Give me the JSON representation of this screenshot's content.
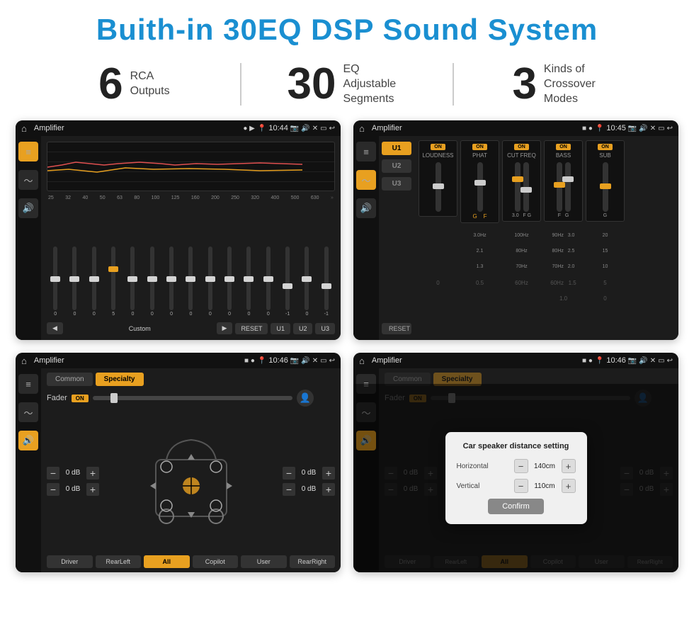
{
  "page": {
    "title": "Buith-in 30EQ DSP Sound System"
  },
  "stats": [
    {
      "number": "6",
      "label": "RCA\nOutputs"
    },
    {
      "number": "30",
      "label": "EQ Adjustable\nSegments"
    },
    {
      "number": "3",
      "label": "Kinds of\nCrossover Modes"
    }
  ],
  "screen1": {
    "status": "Amplifier",
    "time": "10:44",
    "preset": "Custom",
    "freqs": [
      "25",
      "32",
      "40",
      "50",
      "63",
      "80",
      "100",
      "125",
      "160",
      "200",
      "250",
      "320",
      "400",
      "500",
      "630"
    ],
    "values": [
      "0",
      "0",
      "0",
      "5",
      "0",
      "0",
      "0",
      "0",
      "0",
      "0",
      "0",
      "0",
      "-1",
      "0",
      "-1"
    ],
    "thumbPositions": [
      50,
      50,
      50,
      35,
      50,
      50,
      50,
      50,
      50,
      50,
      50,
      50,
      65,
      50,
      65
    ],
    "buttons": [
      "◀",
      "Custom",
      "▶",
      "RESET",
      "U1",
      "U2",
      "U3"
    ]
  },
  "screen2": {
    "status": "Amplifier",
    "time": "10:45",
    "uButtons": [
      "U1",
      "U2",
      "U3"
    ],
    "controls": [
      {
        "label": "LOUDNESS",
        "on": true
      },
      {
        "label": "PHAT",
        "on": true
      },
      {
        "label": "CUT FREQ",
        "on": true
      },
      {
        "label": "BASS",
        "on": true
      },
      {
        "label": "SUB",
        "on": true
      }
    ],
    "resetLabel": "RESET"
  },
  "screen3": {
    "status": "Amplifier",
    "time": "10:46",
    "tabs": [
      "Common",
      "Specialty"
    ],
    "activeTab": "Specialty",
    "faderLabel": "Fader",
    "onLabel": "ON",
    "volumeRows": [
      {
        "value": "0 dB"
      },
      {
        "value": "0 dB"
      },
      {
        "value": "0 dB"
      },
      {
        "value": "0 dB"
      }
    ],
    "buttons": [
      "Driver",
      "RearLeft",
      "All",
      "Copilot",
      "User",
      "RearRight"
    ]
  },
  "screen4": {
    "status": "Amplifier",
    "time": "10:46",
    "tabs": [
      "Common",
      "Specialty"
    ],
    "activeTab": "Specialty",
    "dialog": {
      "title": "Car speaker distance setting",
      "rows": [
        {
          "label": "Horizontal",
          "value": "140cm"
        },
        {
          "label": "Vertical",
          "value": "110cm"
        }
      ],
      "confirmLabel": "Confirm"
    },
    "volumeRows": [
      {
        "value": "0 dB"
      },
      {
        "value": "0 dB"
      }
    ],
    "buttons": [
      "Driver",
      "RearLeft",
      "All",
      "Copilot",
      "User",
      "RearRight"
    ]
  }
}
